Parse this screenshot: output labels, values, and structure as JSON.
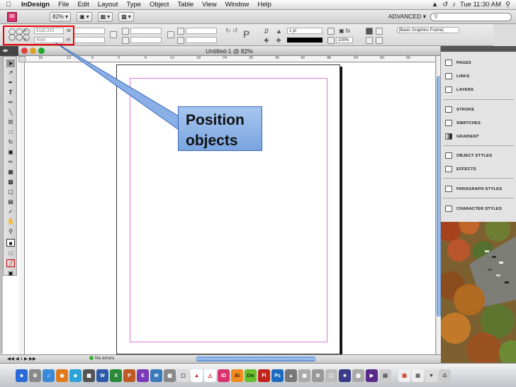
{
  "menubar": {
    "app_name": "InDesign",
    "items": [
      "File",
      "Edit",
      "Layout",
      "Type",
      "Object",
      "Table",
      "View",
      "Window",
      "Help"
    ],
    "clock": "Tue 11:30 AM"
  },
  "appbar": {
    "logo": "ID",
    "zoom": "82%",
    "workspace": "ADVANCED",
    "search_placeholder": ""
  },
  "control": {
    "x_label": "X:",
    "y_label": "Y:",
    "x_value": "61p5.333",
    "y_value": "40p0",
    "w_label": "W",
    "h_label": "H",
    "stroke_weight": "1 pt",
    "scale": "100%",
    "frame_style": "[Basic Graphics Frame]"
  },
  "document": {
    "title": "Untitled-1 @ 82%",
    "ruler_labels": [
      "18",
      "12",
      "6",
      "0",
      "6",
      "12",
      "18",
      "24",
      "30",
      "36",
      "42",
      "48",
      "54",
      "60",
      "66"
    ]
  },
  "statusbar": {
    "page": "1",
    "errors": "No errors"
  },
  "panels": {
    "items": [
      {
        "label": "PAGES",
        "icon": "pages-icon"
      },
      {
        "label": "LINKS",
        "icon": "links-icon"
      },
      {
        "label": "LAYERS",
        "icon": "layers-icon"
      },
      {
        "label": "STROKE",
        "icon": "stroke-icon"
      },
      {
        "label": "SWATCHES",
        "icon": "swatches-icon"
      },
      {
        "label": "GRADIENT",
        "icon": "gradient-icon"
      },
      {
        "label": "OBJECT STYLES",
        "icon": "object-styles-icon"
      },
      {
        "label": "EFFECTS",
        "icon": "effects-icon"
      },
      {
        "label": "PARAGRAPH STYLES",
        "icon": "paragraph-styles-icon"
      },
      {
        "label": "CHARACTER STYLES",
        "icon": "character-styles-icon"
      }
    ]
  },
  "callout": {
    "line1": "Position",
    "line2": "objects",
    "fill": "#94b9eb",
    "border": "#3a68b8"
  },
  "dock": {
    "labels": [
      "Ai",
      "Dw",
      "Fl",
      "Ps"
    ],
    "id_label": "ID"
  },
  "colors": {
    "highlight": "#e00000",
    "margin_guide": "#d77adb",
    "scroll_thumb": "#5b8fd8"
  }
}
